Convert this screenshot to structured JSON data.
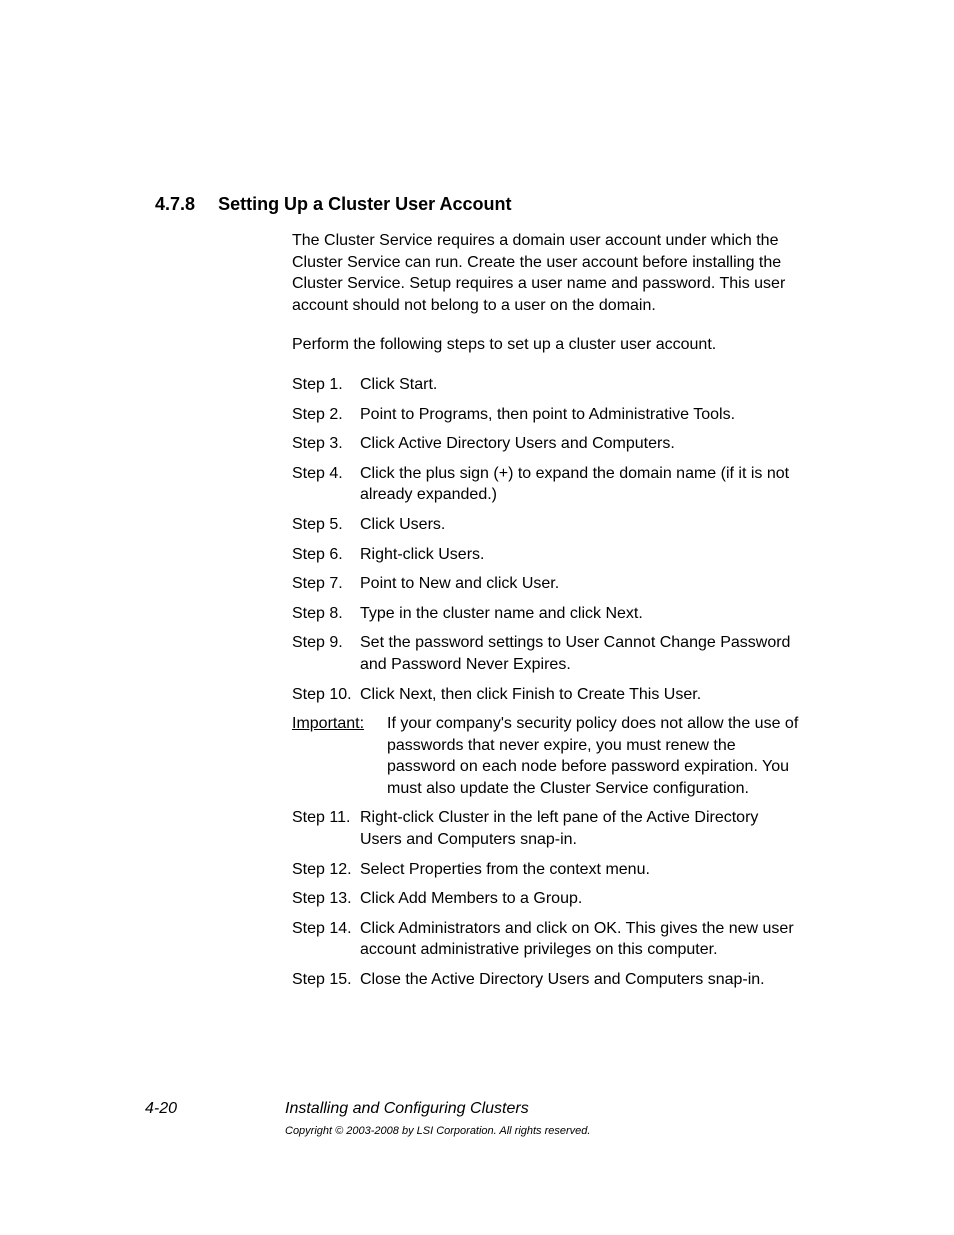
{
  "section": {
    "number": "4.7.8",
    "title": "Setting Up a Cluster User Account"
  },
  "paragraphs": {
    "p1": "The Cluster Service requires a domain user account under which the Cluster Service can run. Create the user account before installing the Cluster Service. Setup requires a user name and password. This user account should not belong to a user on the domain.",
    "p2": "Perform the following steps to set up a cluster user account."
  },
  "steps_a": [
    {
      "label": "Step 1.",
      "text": "Click Start."
    },
    {
      "label": "Step 2.",
      "text": "Point to Programs, then point to Administrative Tools."
    },
    {
      "label": "Step 3.",
      "text": "Click Active Directory Users and Computers."
    },
    {
      "label": "Step 4.",
      "text": "Click the plus sign (+) to expand the domain name (if it is not already expanded.)"
    },
    {
      "label": "Step 5.",
      "text": "Click Users."
    },
    {
      "label": "Step 6.",
      "text": "Right-click Users."
    },
    {
      "label": "Step 7.",
      "text": "Point to New and click User."
    },
    {
      "label": "Step 8.",
      "text": "Type in the cluster name and click Next."
    },
    {
      "label": "Step 9.",
      "text": "Set the password settings to User Cannot Change Password and Password Never Expires."
    },
    {
      "label": "Step 10.",
      "text": "Click Next, then click Finish to Create This User."
    }
  ],
  "important": {
    "label": "Important:",
    "text": "If your company's security policy does not allow the use of passwords that never expire, you must renew the password on each node before password expiration. You must also update the Cluster Service configuration."
  },
  "steps_b": [
    {
      "label": "Step 11.",
      "text": "Right-click Cluster in the left pane of the Active Directory Users and Computers snap-in."
    },
    {
      "label": "Step 12.",
      "text": "Select Properties from the context menu."
    },
    {
      "label": "Step 13.",
      "text": "Click Add Members to a Group."
    },
    {
      "label": "Step 14.",
      "text": "Click Administrators and click on OK. This gives the new user account administrative privileges on this computer."
    },
    {
      "label": "Step 15.",
      "text": "Close the Active Directory Users and Computers snap-in."
    }
  ],
  "footer": {
    "page": "4-20",
    "chapter": "Installing and Configuring Clusters",
    "copyright": "Copyright © 2003-2008 by LSI Corporation. All rights reserved."
  }
}
